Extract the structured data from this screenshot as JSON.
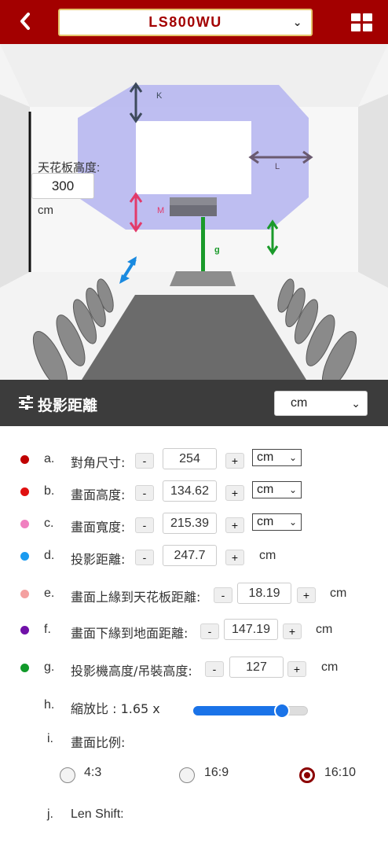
{
  "header": {
    "model": "LS800WU",
    "back_icon": "chevron-left-icon",
    "grid_icon": "grid-icon"
  },
  "scene": {
    "ceiling_label": "天花板高度:",
    "ceiling_value": "300",
    "ceiling_unit": "cm",
    "tags": {
      "k": "K",
      "l": "L",
      "m": "M",
      "g": "g"
    },
    "colors": {
      "throw_area": "#b4b4f0",
      "wall": "#ececec",
      "screen": "#ffffff",
      "height_arrow": "#2e9b2e"
    }
  },
  "section": {
    "title": "投影距離",
    "unit": "cm"
  },
  "rows": [
    {
      "letter": "a.",
      "label": "對角尺寸:",
      "value": "254",
      "unit": "cm",
      "color": "#c00000"
    },
    {
      "letter": "b.",
      "label": "畫面高度:",
      "value": "134.62",
      "unit": "cm",
      "color": "#e01010"
    },
    {
      "letter": "c.",
      "label": "畫面寬度:",
      "value": "215.39",
      "unit": "cm",
      "color": "#f080c0"
    },
    {
      "letter": "d.",
      "label": "投影距離:",
      "value": "247.7",
      "unit": "cm",
      "color": "#1a9bf0"
    },
    {
      "letter": "e.",
      "label": "畫面上緣到天花板距離:",
      "value": "18.19",
      "unit": "cm",
      "color": "#f4a0a0"
    },
    {
      "letter": "f.",
      "label": "畫面下緣到地面距離:",
      "value": "147.19",
      "unit": "cm",
      "color": "#7010a8"
    },
    {
      "letter": "g.",
      "label": "投影機高度/吊裝高度:",
      "value": "127",
      "unit": "cm",
      "color": "#119a2a"
    }
  ],
  "buttons": {
    "minus": "-",
    "plus": "+"
  },
  "zoom": {
    "letter": "h.",
    "label": "縮放比 : 1.65 x",
    "level": 0.82
  },
  "aspect": {
    "letter": "i.",
    "label": "畫面比例:",
    "options": [
      "4:3",
      "16:9",
      "16:10"
    ],
    "selected": "16:10"
  },
  "lens": {
    "letter": "j.",
    "label": "Len Shift:"
  }
}
